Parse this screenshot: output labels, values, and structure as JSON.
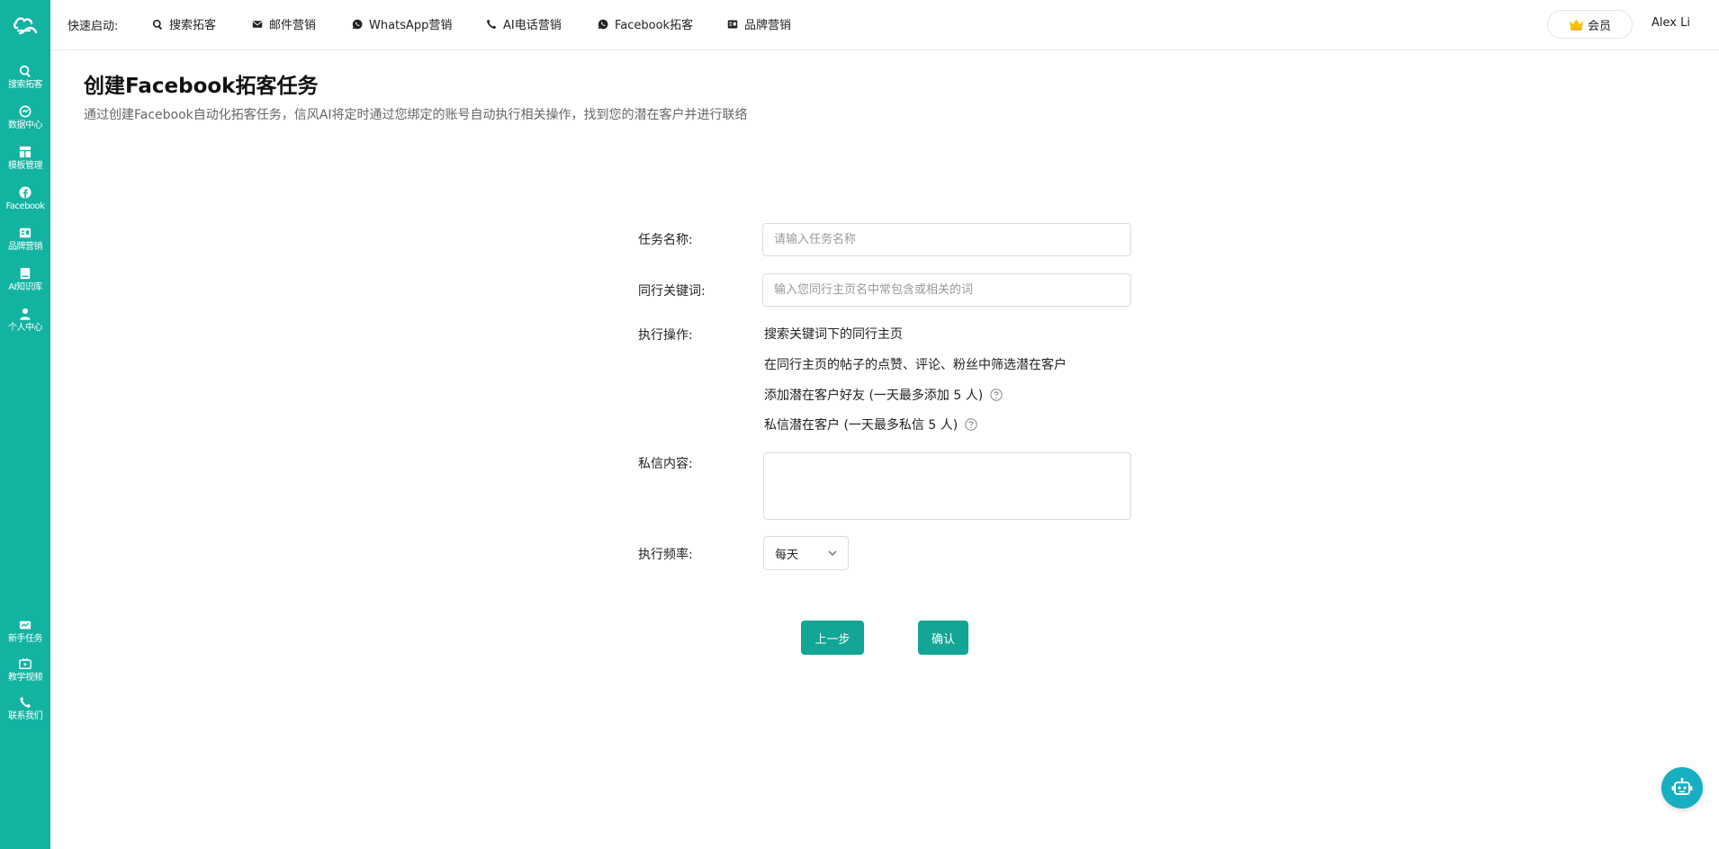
{
  "sidebar": {
    "top_items": [
      {
        "label": "搜索拓客",
        "icon": "search-icon"
      },
      {
        "label": "数据中心",
        "icon": "data-icon"
      },
      {
        "label": "模板管理",
        "icon": "template-icon"
      },
      {
        "label": "Facebook",
        "icon": "facebook-icon"
      },
      {
        "label": "品牌营销",
        "icon": "brand-icon"
      },
      {
        "label": "AI知识库",
        "icon": "book-icon"
      },
      {
        "label": "个人中心",
        "icon": "user-icon"
      }
    ],
    "bottom_items": [
      {
        "label": "新手任务",
        "icon": "task-icon"
      },
      {
        "label": "教学视频",
        "icon": "video-icon"
      },
      {
        "label": "联系我们",
        "icon": "phone-icon"
      }
    ]
  },
  "topbar": {
    "quick_label": "快速启动:",
    "nav": [
      {
        "label": "搜索拓客",
        "icon": "search-icon"
      },
      {
        "label": "邮件营销",
        "icon": "mail-icon"
      },
      {
        "label": "WhatsApp营销",
        "icon": "whatsapp-icon"
      },
      {
        "label": "AI电话营销",
        "icon": "phone-icon"
      },
      {
        "label": "Facebook拓客",
        "icon": "whatsapp-icon"
      },
      {
        "label": "品牌营销",
        "icon": "brand-icon"
      }
    ],
    "vip_label": "会员",
    "user_name": "Alex Li"
  },
  "page": {
    "title": "创建Facebook拓客任务",
    "description": "通过创建Facebook自动化拓客任务，信风AI将定时通过您绑定的账号自动执行相关操作，找到您的潜在客户并进行联络"
  },
  "form": {
    "task_name": {
      "label": "任务名称:",
      "value": "",
      "placeholder": "请输入任务名称"
    },
    "keyword": {
      "label": "同行关键词:",
      "value": "",
      "placeholder": "输入您同行主页名中常包含或相关的词"
    },
    "operations": {
      "label": "执行操作:",
      "items": [
        "搜索关键词下的同行主页",
        "在同行主页的帖子的点赞、评论、粉丝中筛选潜在客户",
        "添加潜在客户好友 (一天最多添加 5 人)",
        "私信潜在客户 (一天最多私信 5 人)"
      ]
    },
    "message": {
      "label": "私信内容:",
      "value": ""
    },
    "frequency": {
      "label": "执行频率:",
      "value": "每天"
    },
    "prev_button": "上一步",
    "confirm_button": "确认"
  },
  "colors": {
    "primary": "#13b3a2",
    "button": "#13a596",
    "robot": "#17aec2"
  }
}
